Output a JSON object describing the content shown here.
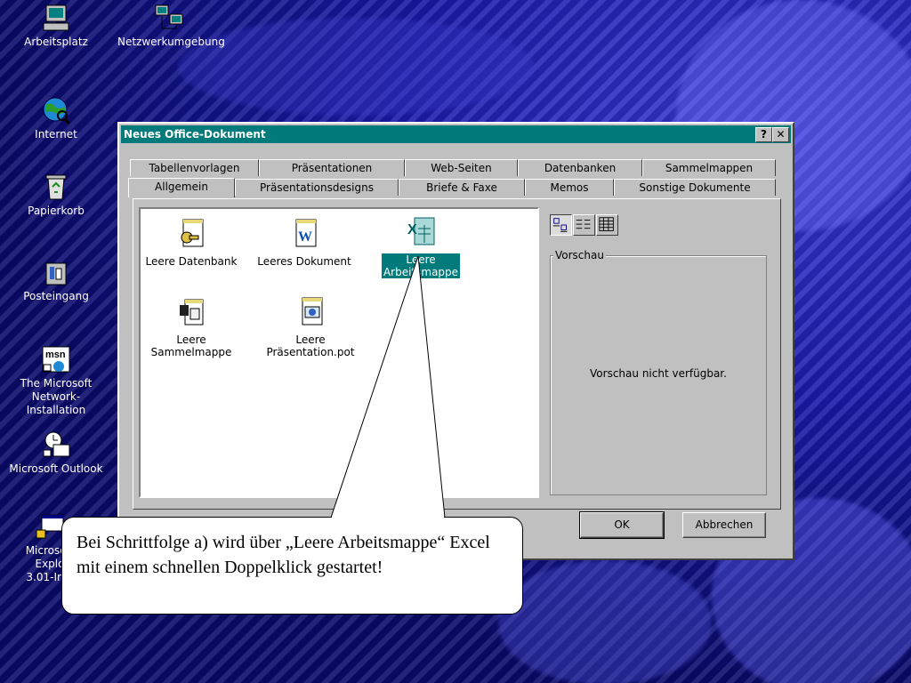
{
  "desktop": {
    "icons": [
      {
        "label": "Arbeitsplatz",
        "icon": "my-computer-icon"
      },
      {
        "label": "Netzwerkumgebung",
        "icon": "network-neighborhood-icon"
      },
      {
        "label": "Internet",
        "icon": "internet-globe-icon"
      },
      {
        "label": "Papierkorb",
        "icon": "recycle-bin-icon"
      },
      {
        "label": "Posteingang",
        "icon": "inbox-icon"
      },
      {
        "label": "The Microsoft\nNetwork-Installation",
        "icon": "msn-icon"
      },
      {
        "label": "Microsoft Outlook",
        "icon": "outlook-icon"
      },
      {
        "label": "Microsoft\nExplo\n3.01-Inst",
        "icon": "internet-explorer-setup-icon"
      }
    ]
  },
  "dialog": {
    "title": "Neues Office-Dokument",
    "help_button": "?",
    "close_button": "✕",
    "tabs_back": [
      "Tabellenvorlagen",
      "Präsentationen",
      "Web-Seiten",
      "Datenbanken",
      "Sammelmappen"
    ],
    "tabs_front": [
      "Allgemein",
      "Präsentationsdesigns",
      "Briefe & Faxe",
      "Memos",
      "Sonstige Dokumente"
    ],
    "active_tab": "Allgemein",
    "items": [
      {
        "label": "Leere Datenbank",
        "icon": "access-database-icon"
      },
      {
        "label": "Leeres Dokument",
        "icon": "word-document-icon"
      },
      {
        "label": "Leere\nArbeitsmappe",
        "icon": "excel-workbook-icon",
        "selected": true
      },
      {
        "label": "Leere\nSammelmappe",
        "icon": "binder-icon"
      },
      {
        "label": "Leere\nPräsentation.pot",
        "icon": "powerpoint-presentation-icon"
      }
    ],
    "view_buttons": [
      "large-icons-icon",
      "list-view-icon",
      "details-view-icon"
    ],
    "preview": {
      "label": "Vorschau",
      "message": "Vorschau nicht verfügbar."
    },
    "ok_label": "OK",
    "cancel_label": "Abbrechen"
  },
  "callout": {
    "text": "Bei Schrittfolge a) wird über „Leere Arbeitsmappe“ Excel mit einem schnellen Doppelklick gestartet!"
  },
  "colors": {
    "titlebar": "#007a7a",
    "selection": "#007a7a",
    "dialog_face": "#c0c0c0",
    "desktop": "#12128f"
  }
}
